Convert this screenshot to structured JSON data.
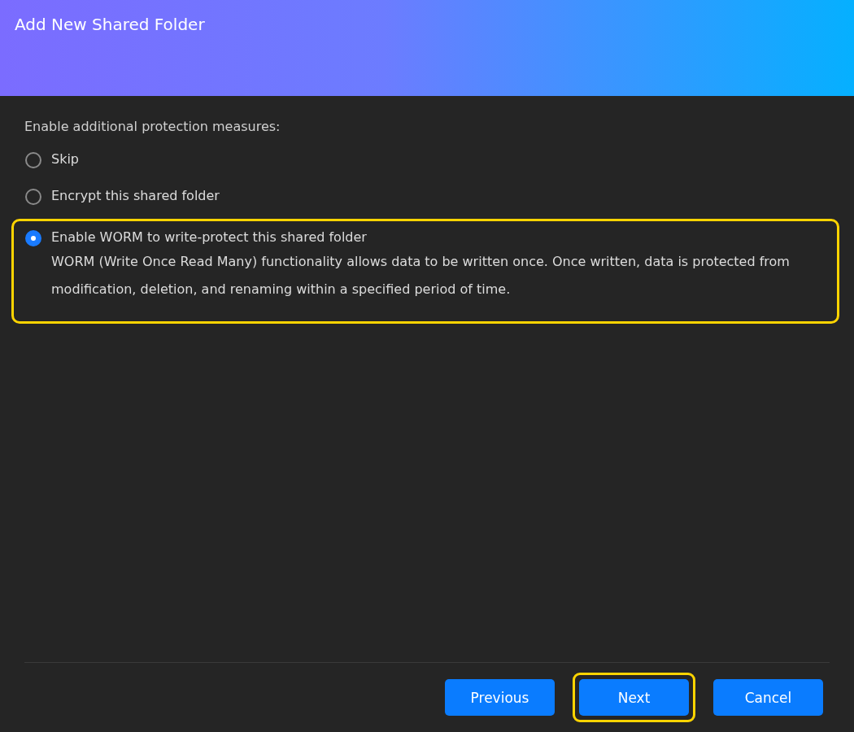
{
  "window": {
    "title": "Add New Shared Folder"
  },
  "prompt": "Enable additional protection measures:",
  "options": [
    {
      "label": "Skip",
      "selected": false,
      "highlighted": false
    },
    {
      "label": "Encrypt this shared folder",
      "selected": false,
      "highlighted": false
    },
    {
      "label": "Enable WORM to write-protect this shared folder",
      "description": "WORM (Write Once Read Many) functionality allows data to be written once. Once written, data is protected from modification, deletion, and renaming within a specified period of time.",
      "selected": true,
      "highlighted": true
    }
  ],
  "buttons": [
    {
      "label": "Previous",
      "highlighted": false
    },
    {
      "label": "Next",
      "highlighted": true
    },
    {
      "label": "Cancel",
      "highlighted": false
    }
  ]
}
